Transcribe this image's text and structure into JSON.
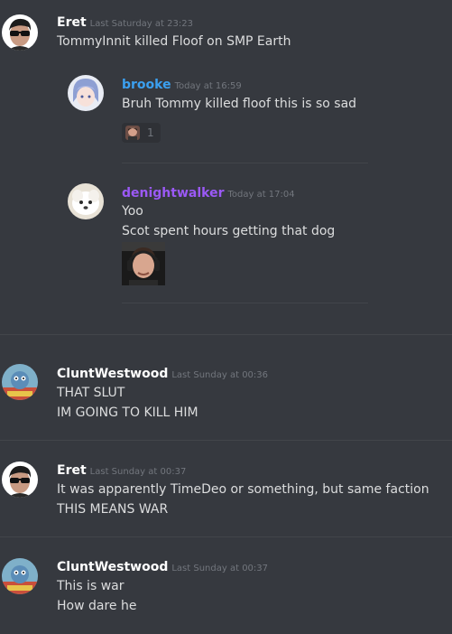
{
  "messages": [
    {
      "username": "Eret",
      "timestamp": "Last Saturday at 23:23",
      "lines": [
        "TommyInnit killed Floof on SMP Earth"
      ]
    },
    {
      "username": "brooke",
      "timestamp": "Today at 16:59",
      "lines": [
        "Bruh Tommy killed floof this is so sad"
      ],
      "reaction_count": "1"
    },
    {
      "username": "denightwalker",
      "timestamp": "Today at 17:04",
      "lines": [
        "Yoo",
        "Scot spent hours getting that dog"
      ]
    },
    {
      "username": "CluntWestwood",
      "timestamp": "Last Sunday at 00:36",
      "lines": [
        "THAT SLUT",
        "IM GOING TO KILL HIM"
      ]
    },
    {
      "username": "Eret",
      "timestamp": "Last Sunday at 00:37",
      "lines": [
        "It was apparently TimeDeo or something, but same faction",
        "THIS MEANS WAR"
      ]
    },
    {
      "username": "CluntWestwood",
      "timestamp": "Last Sunday at 00:37",
      "lines": [
        "This is war",
        "How dare he"
      ]
    }
  ],
  "colors": {
    "background": "#36393f",
    "username_default": "#ffffff",
    "username_brooke": "#3ba0f0",
    "username_denightwalker": "#9b59f6",
    "timestamp": "#72767d",
    "text": "#dcddde",
    "divider": "#42454a"
  },
  "icons": {
    "eret_avatar": "sunglasses-man-avatar-icon",
    "brooke_avatar": "anime-character-avatar-icon",
    "denightwalker_avatar": "white-dog-avatar-icon",
    "clunt_avatar": "cartoon-avatar-icon",
    "reaction": "face-emoji-icon",
    "embed": "person-headset-image"
  }
}
